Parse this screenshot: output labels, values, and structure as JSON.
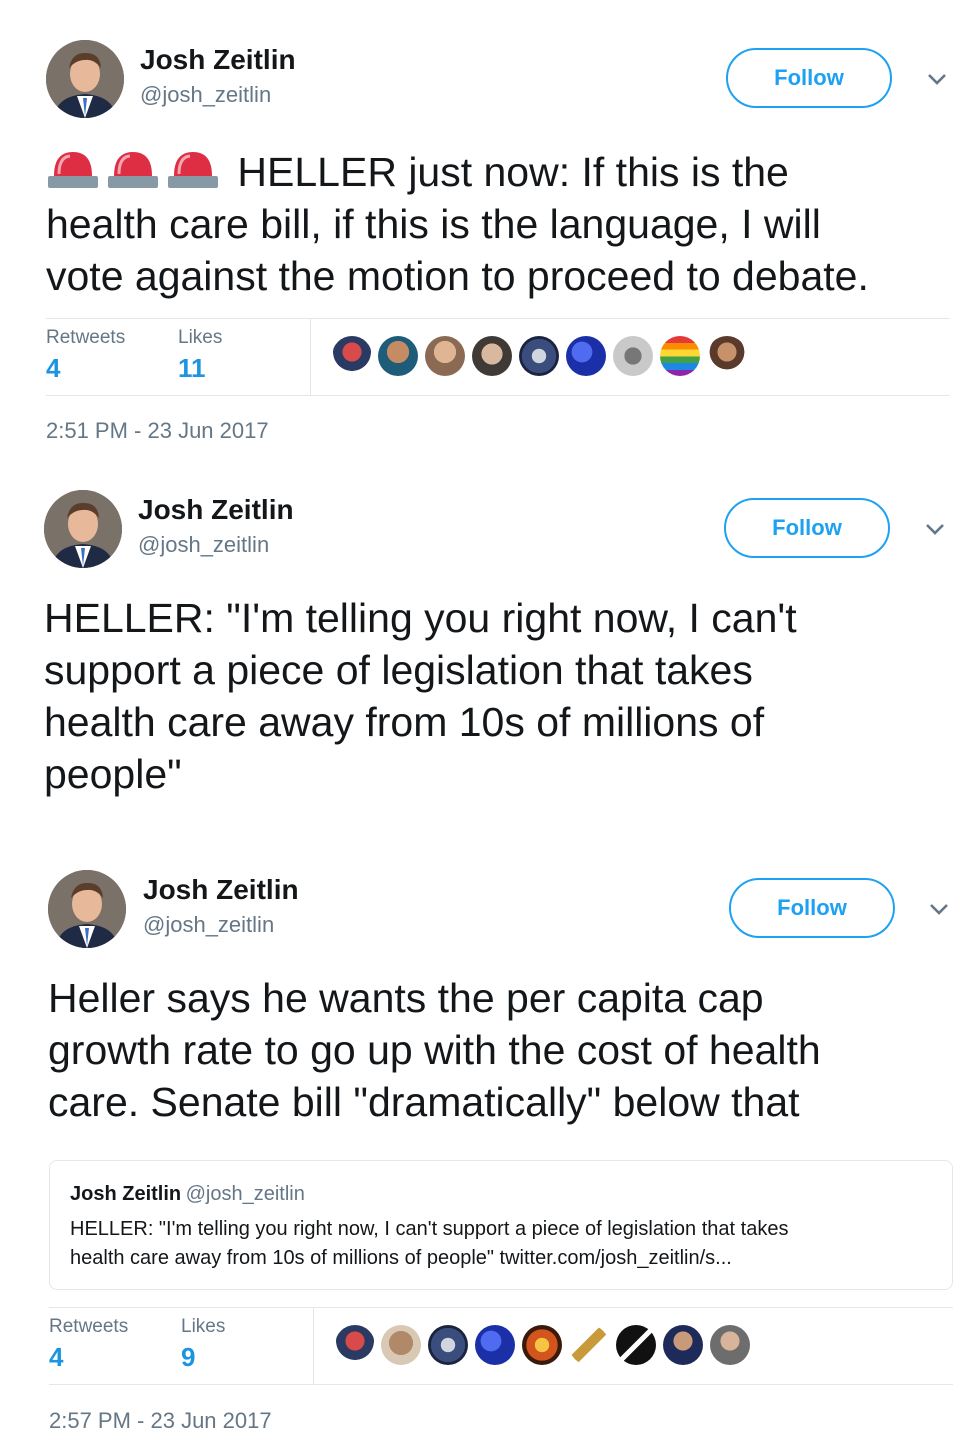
{
  "tweets": [
    {
      "author": "Josh Zeitlin",
      "handle": "@josh_zeitlin",
      "follow_label": "Follow",
      "emoji": [
        "rotating-light",
        "rotating-light",
        "rotating-light"
      ],
      "lines": [
        "HELLER just now: If this is the",
        "health care bill, if this is the language, I will",
        "vote against the motion to proceed to debate."
      ],
      "retweets_label": "Retweets",
      "retweets": "4",
      "likes_label": "Likes",
      "likes": "11",
      "liker_avatar_count": 9,
      "timestamp": "2:51 PM - 23 Jun 2017"
    },
    {
      "author": "Josh Zeitlin",
      "handle": "@josh_zeitlin",
      "follow_label": "Follow",
      "lines": [
        "HELLER: \"I'm telling you right now, I can't",
        "support a piece of legislation that takes",
        "health care away from 10s of millions of",
        "people\""
      ]
    },
    {
      "author": "Josh Zeitlin",
      "handle": "@josh_zeitlin",
      "follow_label": "Follow",
      "lines": [
        "Heller says he wants the per capita cap",
        "growth rate to go up with the cost of health",
        "care. Senate bill \"dramatically\" below that"
      ],
      "quoted": {
        "author": "Josh Zeitlin",
        "handle": "@josh_zeitlin",
        "lines": [
          "HELLER: \"I'm telling you right now, I can't support a piece of legislation that takes",
          "health care away from 10s of millions of people\" twitter.com/josh_zeitlin/s..."
        ]
      },
      "retweets_label": "Retweets",
      "retweets": "4",
      "likes_label": "Likes",
      "likes": "9",
      "liker_avatar_count": 9,
      "timestamp": "2:57 PM - 23 Jun 2017"
    }
  ],
  "colors": {
    "link_blue": "#1da1f2",
    "stat_blue": "#1b95e0",
    "secondary_text": "#657786",
    "divider": "#e1e8ed",
    "siren_red": "#dd2e44"
  }
}
